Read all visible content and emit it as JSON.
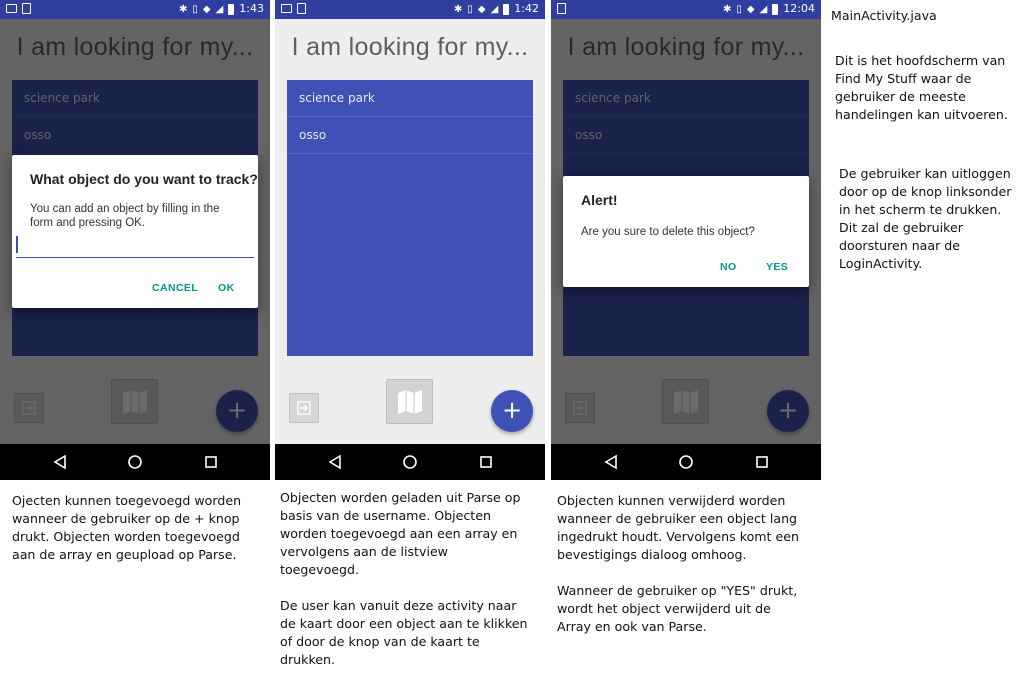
{
  "app_title": "I am looking for my...",
  "list_items": [
    "science park",
    "osso"
  ],
  "fab_label": "+",
  "screens": {
    "add": {
      "time": "1:43",
      "dialog_title": "What object do you want to track?",
      "dialog_message": "You can add an object by filling in the form and pressing OK.",
      "input_value": "",
      "cancel_label": "CANCEL",
      "ok_label": "OK",
      "caption": "Ojecten kunnen toegevoegd worden wanneer de gebruiker op de + knop drukt. Objecten worden toegevoegd aan de array en geupload op Parse."
    },
    "main": {
      "time": "1:42",
      "caption_p1": "Objecten worden geladen uit Parse op basis van de username. Objecten worden toegevoegd aan een array en vervolgens aan de listview toegevoegd.",
      "caption_p2": "De user kan vanuit deze activity naar de kaart door een object aan te klikken of door de knop van de kaart te drukken."
    },
    "delete": {
      "time": "12:04",
      "dialog_title": "Alert!",
      "dialog_message": "Are you sure to delete this object?",
      "no_label": "NO",
      "yes_label": "YES",
      "caption_p1": "Objecten kunnen verwijderd worden wanneer de gebruiker een object lang ingedrukt houdt. Vervolgens komt een bevestigings dialoog omhoog.",
      "caption_p2": "Wanneer de gebruiker op \"YES\" drukt, wordt het object verwijderd uit de Array en ook van Parse."
    }
  },
  "side": {
    "filename": "MainActivity.java",
    "para1": "Dit is het hoofdscherm van Find My Stuff waar de gebruiker de meeste handelingen kan uitvoeren.",
    "para2": "De gebruiker kan uitloggen door op de knop linksonder in het scherm te drukken. Dit zal de gebruiker doorsturen naar de LoginActivity."
  },
  "icons": [
    "image-icon",
    "phone-icon",
    "bluetooth-icon",
    "vibrate-icon",
    "wifi-icon",
    "signal-icon",
    "battery-icon",
    "logout-icon",
    "map-icon",
    "back-icon",
    "home-icon",
    "recents-icon"
  ],
  "colors": {
    "primary": "#3f51b5",
    "status_bar": "#303f9f",
    "accent_text": "#009688"
  }
}
